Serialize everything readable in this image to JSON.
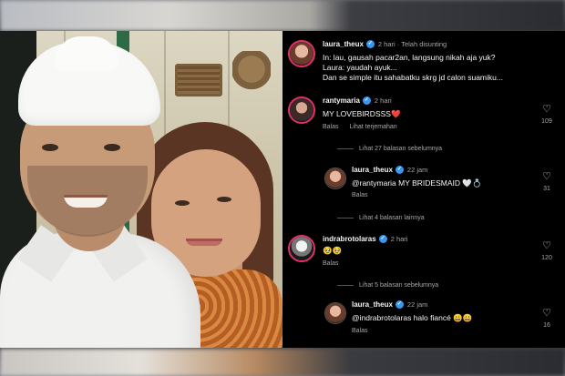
{
  "comments": [
    {
      "username": "laura_theux",
      "meta": "2 hari · Telah disunting",
      "lines": [
        "In: lau, gausah pacar2an, langsung nikah aja yuk?",
        "Laura: yaudah ayuk...",
        "Dan se simple itu sahabatku skrg jd calon suamiku..."
      ]
    },
    {
      "username": "rantymaria",
      "meta": "2 hari",
      "text": "MY LOVEBIRDSSS❤️",
      "reply_label": "Balas",
      "translate_label": "Lihat terjemahan",
      "likes": "109",
      "thread_label": "Lihat 27 balasan sebelumnya"
    },
    {
      "username": "laura_theux",
      "meta": "22 jam",
      "text": "@rantymaria MY BRIDESMAID 🤍💍",
      "reply_label": "Balas",
      "likes": "31",
      "thread_label": "Lihat 4 balasan lainnya"
    },
    {
      "username": "indrabrotolaras",
      "meta": "2 hari",
      "text": "🥹🥹",
      "reply_label": "Balas",
      "likes": "120",
      "thread_label": "Lihat 5 balasan sebelumnya"
    },
    {
      "username": "laura_theux",
      "meta": "22 jam",
      "text": "@indrabrotolaras halo fiancé 😀😀",
      "reply_label": "Balas",
      "likes": "16"
    }
  ],
  "icons": {
    "heart": "♡",
    "verified": "✓"
  },
  "colors": {
    "background": "#000000",
    "verified": "#3897f0",
    "story_ring": "#e1306c"
  }
}
